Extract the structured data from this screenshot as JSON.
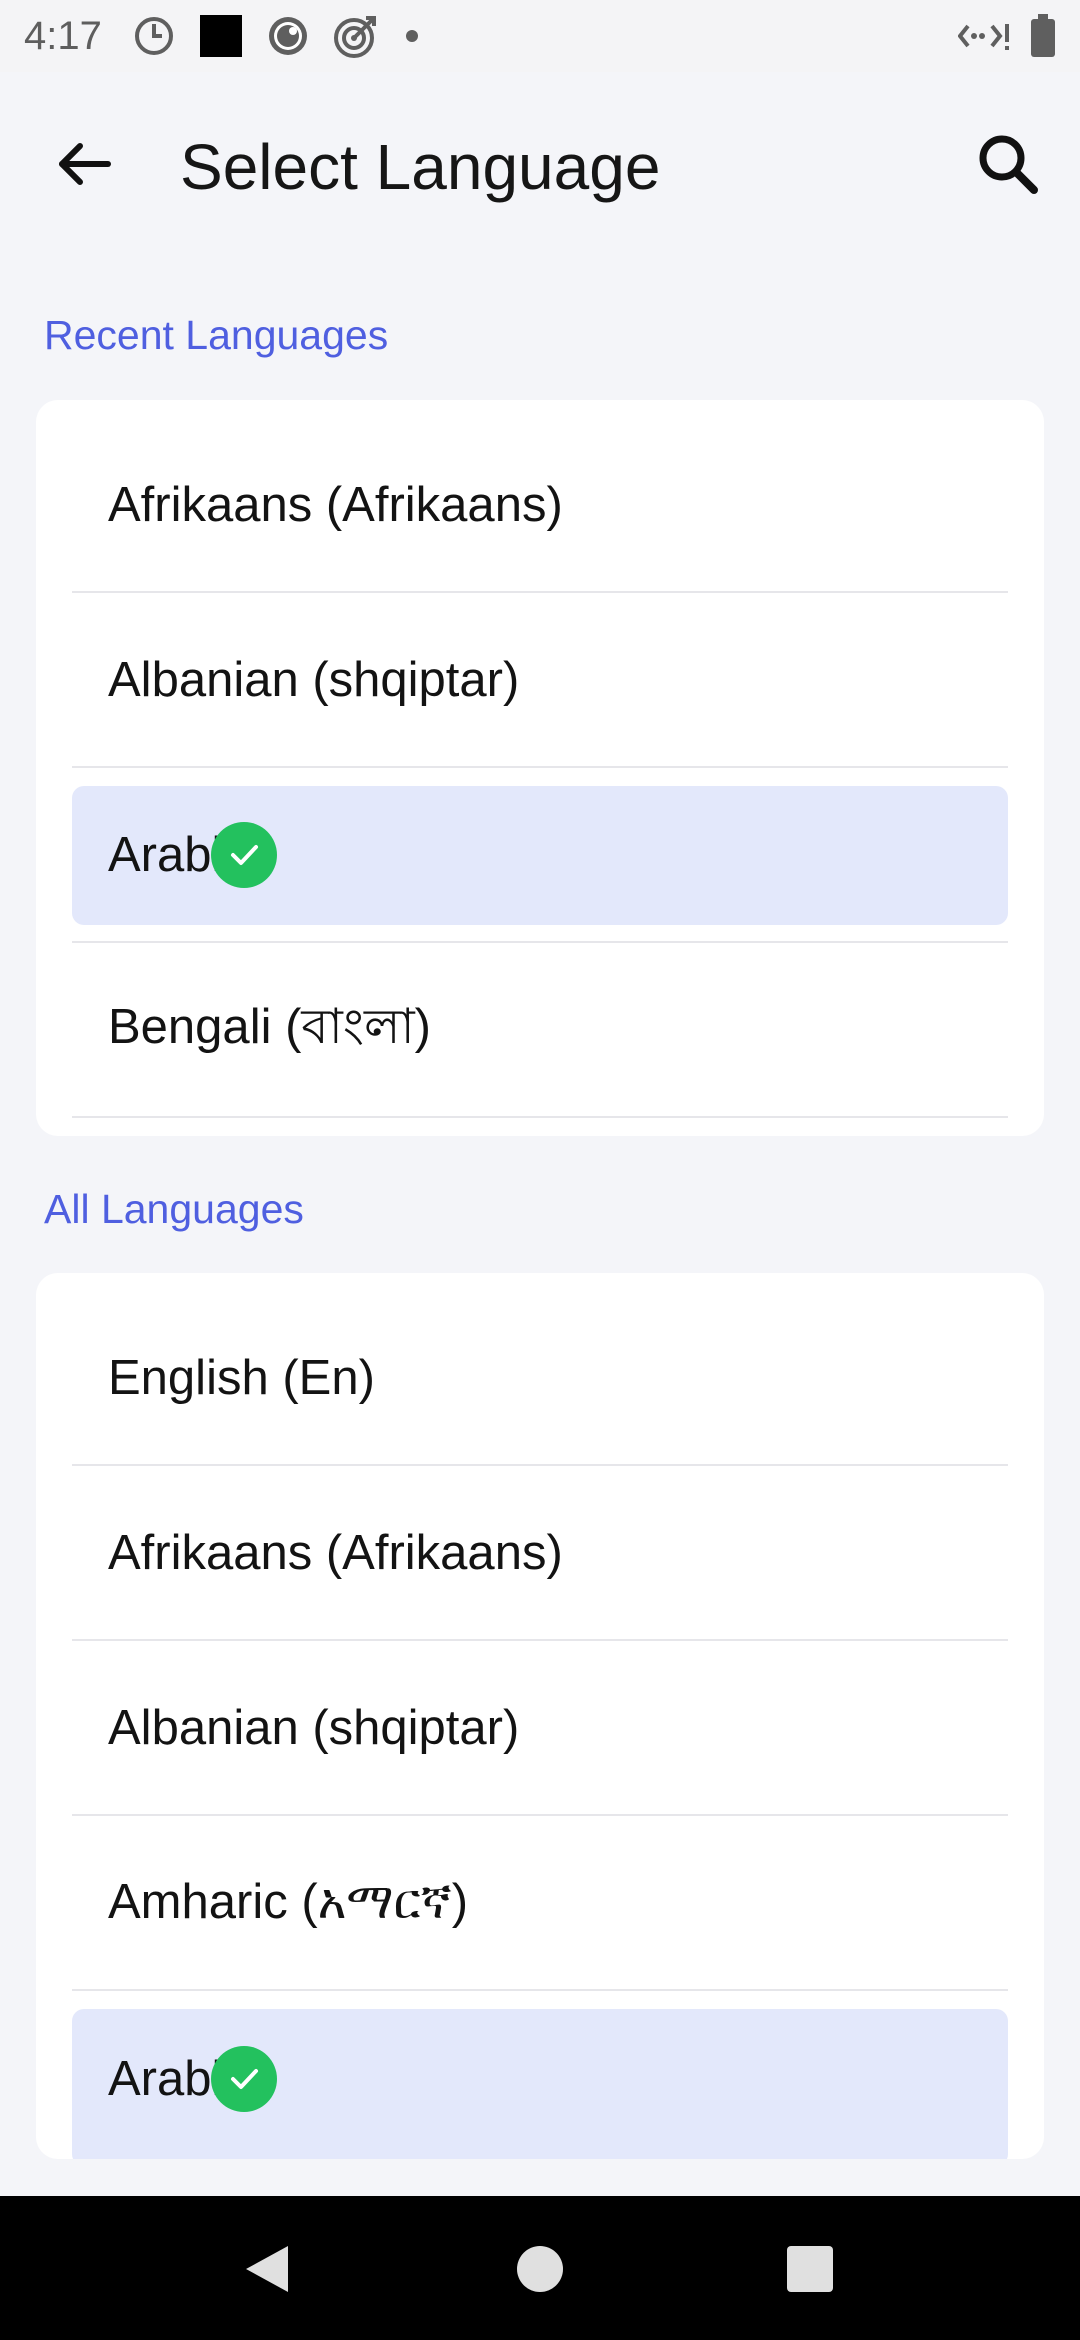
{
  "status_bar": {
    "time": "4:17",
    "left_icons": [
      "do-not-disturb-icon",
      "square-app-icon",
      "camera-lens-icon",
      "target-icon",
      "dot-icon"
    ],
    "right_icons": [
      "signal-icon",
      "battery-icon"
    ]
  },
  "app_bar": {
    "title": "Select Language",
    "back_icon": "arrow-left-icon",
    "search_icon": "search-icon"
  },
  "recent": {
    "heading": "Recent Languages",
    "items": [
      {
        "label": "Afrikaans (Afrikaans)",
        "selected": false
      },
      {
        "label": "Albanian (shqiptar)",
        "selected": false
      },
      {
        "label": "Arabic",
        "selected": true
      },
      {
        "label": "Bengali (বাংলা)",
        "selected": false
      }
    ]
  },
  "all": {
    "heading": "All Languages",
    "items": [
      {
        "label": "English (En)",
        "selected": false
      },
      {
        "label": "Afrikaans (Afrikaans)",
        "selected": false
      },
      {
        "label": "Albanian (shqiptar)",
        "selected": false
      },
      {
        "label": "Amharic (አማርኛ)",
        "selected": false
      },
      {
        "label": "Arabic",
        "selected": true
      }
    ]
  },
  "colors": {
    "accent": "#4f5fe0",
    "selected_bg": "#e3e8fb",
    "check": "#23c15e"
  },
  "nav_bar": {
    "icons": [
      "back-triangle-icon",
      "home-circle-icon",
      "recents-square-icon"
    ]
  }
}
